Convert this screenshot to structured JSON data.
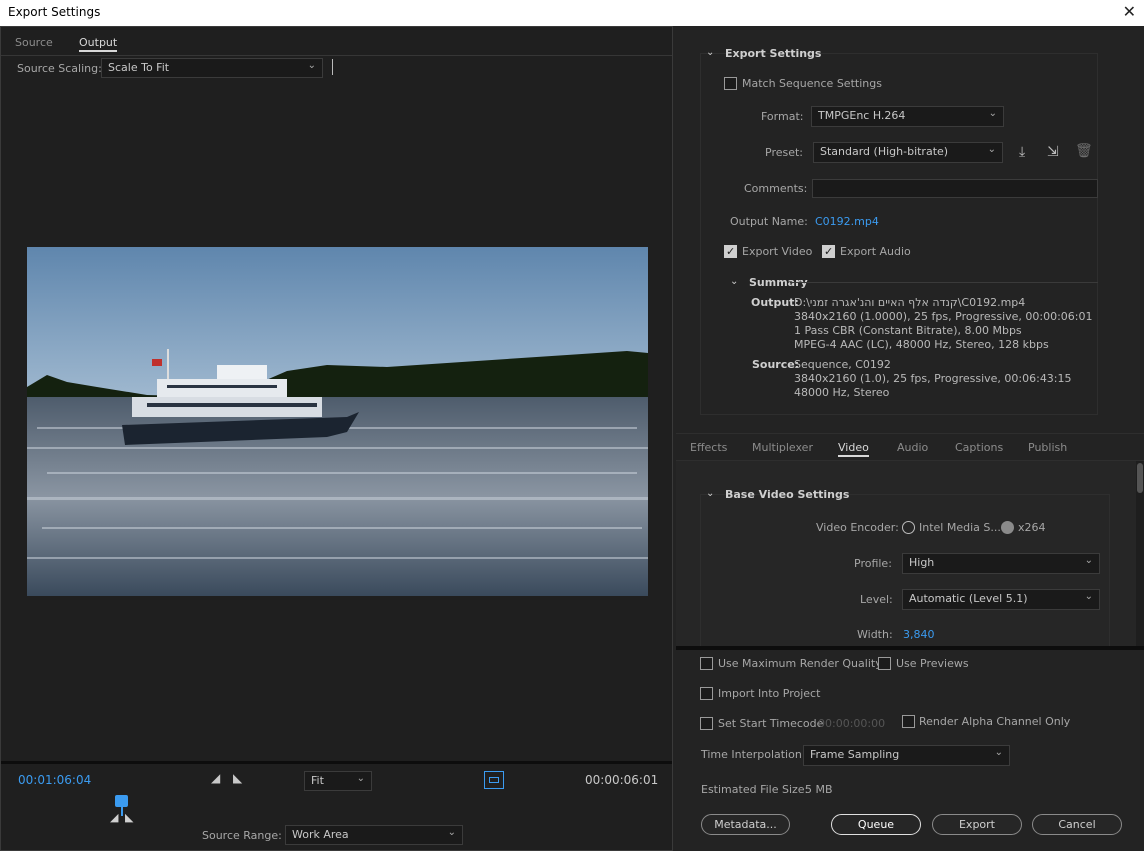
{
  "window": {
    "title": "Export Settings",
    "close_glyph": "✕"
  },
  "left": {
    "tabs": [
      {
        "label": "Source",
        "active": false
      },
      {
        "label": "Output",
        "active": true
      }
    ],
    "source_scaling": {
      "label": "Source Scaling:",
      "value": "Scale To Fit"
    },
    "timecode_current": "00:01:06:04",
    "timecode_duration": "00:00:06:01",
    "zoom": {
      "value": "Fit"
    },
    "source_range": {
      "label": "Source Range:",
      "value": "Work Area"
    }
  },
  "export_settings": {
    "title": "Export Settings",
    "match_sequence_label": "Match Sequence Settings",
    "format_label": "Format:",
    "format_value": "TMPGEnc H.264",
    "preset_label": "Preset:",
    "preset_value": "Standard (High-bitrate)",
    "comments_label": "Comments:",
    "comments_value": "",
    "output_name_label": "Output Name:",
    "output_name_value": "C0192.mp4",
    "export_video_label": "Export Video",
    "export_audio_label": "Export Audio",
    "summary": {
      "title": "Summary",
      "output_label": "Output:",
      "output_lines": [
        "D:\\קנדה אלף האיים והנ'אגרה זמני\\C0192.mp4",
        "3840x2160 (1.0000), 25 fps, Progressive, 00:00:06:01",
        "1 Pass CBR (Constant Bitrate), 8.00 Mbps",
        "MPEG-4 AAC (LC), 48000 Hz, Stereo, 128 kbps"
      ],
      "source_label": "Source:",
      "source_lines": [
        "Sequence, C0192",
        "3840x2160 (1.0), 25 fps, Progressive, 00:06:43:15",
        "48000 Hz, Stereo"
      ]
    }
  },
  "settings_tabs": [
    {
      "label": "Effects",
      "active": false
    },
    {
      "label": "Multiplexer",
      "active": false
    },
    {
      "label": "Video",
      "active": true
    },
    {
      "label": "Audio",
      "active": false
    },
    {
      "label": "Captions",
      "active": false
    },
    {
      "label": "Publish",
      "active": false
    }
  ],
  "video": {
    "section_title": "Base Video Settings",
    "encoder_label": "Video Encoder:",
    "encoder_opt1": "Intel Media S...",
    "encoder_opt2": "x264",
    "profile_label": "Profile:",
    "profile_value": "High",
    "level_label": "Level:",
    "level_value": "Automatic (Level 5.1)",
    "width_label": "Width:",
    "width_value": "3,840"
  },
  "bottom": {
    "max_quality_label": "Use Maximum Render Quality",
    "use_previews_label": "Use Previews",
    "import_project_label": "Import Into Project",
    "start_timecode_label": "Set Start Timecode",
    "start_timecode_value": "00:00:00:00",
    "alpha_label": "Render Alpha Channel Only",
    "time_interp_label": "Time Interpolation:",
    "time_interp_value": "Frame Sampling",
    "file_size_label": "Estimated File Size:",
    "file_size_value": "5 MB",
    "buttons": {
      "metadata": "Metadata...",
      "queue": "Queue",
      "export": "Export",
      "cancel": "Cancel"
    }
  },
  "colors": {
    "accent": "#3b9bf0",
    "bg": "#232323"
  }
}
